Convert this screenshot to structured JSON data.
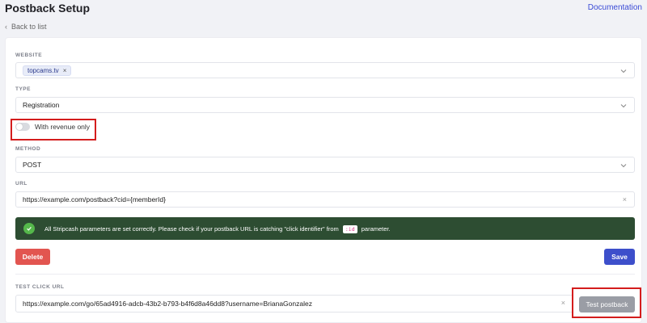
{
  "header": {
    "title": "Postback Setup",
    "documentation_label": "Documentation",
    "back_label": "Back to list"
  },
  "website": {
    "label": "WEBSITE",
    "selected_tag": "topcams.tv"
  },
  "type": {
    "label": "TYPE",
    "value": "Registration"
  },
  "revenue_toggle": {
    "label": "With revenue only",
    "enabled": false
  },
  "method": {
    "label": "METHOD",
    "value": "POST"
  },
  "url": {
    "label": "URL",
    "value": "https://example.com/postback?cid={memberId}"
  },
  "alert": {
    "text_before": "All Stripcash parameters are set correctly. Please check if your postback URL is catching \"click identifier\" from",
    "code": ":id",
    "text_after": "parameter.",
    "color": "#2d4d32"
  },
  "actions": {
    "delete_label": "Delete",
    "save_label": "Save"
  },
  "test_click": {
    "label": "TEST CLICK URL",
    "value": "https://example.com/go/65ad4916-adcb-43b2-b793-b4f6d8a46dd8?username=BrianaGonzalez",
    "button_label": "Test postback"
  },
  "colors": {
    "accent": "#3d4fcb",
    "danger": "#e25550",
    "highlight": "#d41d1d",
    "success": "#55b84b"
  }
}
